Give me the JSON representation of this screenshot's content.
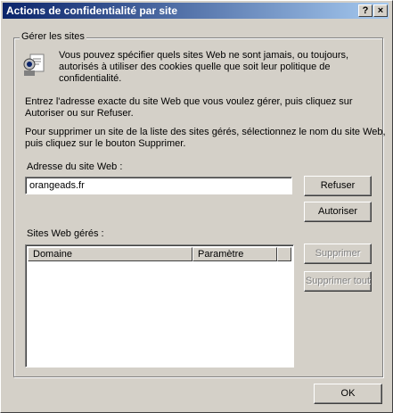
{
  "window": {
    "title": "Actions de confidentialité par site",
    "help_label": "?",
    "close_label": "×"
  },
  "group": {
    "label": "Gérer les sites",
    "info_lines": [
      "Vous pouvez spécifier quels sites Web ne sont jamais, ou toujours,",
      "autorisés à utiliser des cookies quelle que soit leur politique de",
      "confidentialité."
    ],
    "instruction1_lines": [
      "Entrez l'adresse exacte du site Web que vous voulez gérer, puis cliquez sur",
      "Autoriser ou sur Refuser."
    ],
    "instruction2_lines": [
      "Pour supprimer un site de la liste des sites gérés, sélectionnez le nom du site Web,",
      "puis cliquez sur le bouton Supprimer."
    ],
    "address_label": "Adresse du site Web :",
    "address_value": "orangeads.fr",
    "managed_label": "Sites Web gérés :",
    "columns": [
      "Domaine",
      "Paramètre"
    ],
    "rows": []
  },
  "buttons": {
    "refuse": "Refuser",
    "allow": "Autoriser",
    "remove": "Supprimer",
    "remove_all": "Supprimer tout",
    "ok": "OK"
  }
}
